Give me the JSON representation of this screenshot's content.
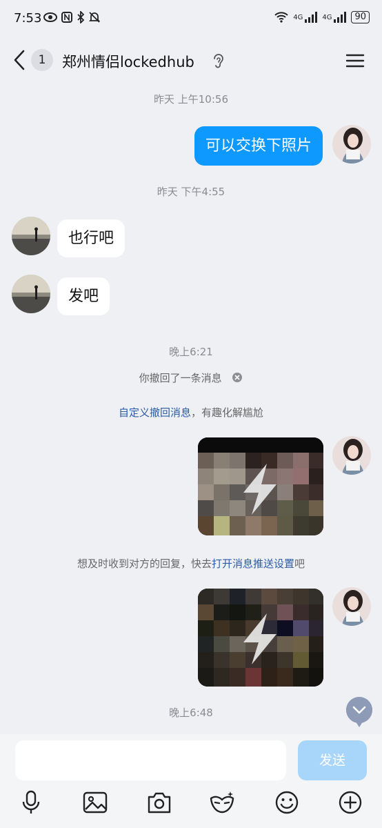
{
  "status_bar": {
    "time": "7:53",
    "signal1": "4G",
    "signal2": "4G",
    "battery": "90"
  },
  "header": {
    "unread_count": "1",
    "title": "郑州情侣lockedhub"
  },
  "messages": {
    "ts1": "昨天 上午10:56",
    "msg1": "可以交换下照片",
    "ts2": "昨天 下午4:55",
    "msg2": "也行吧",
    "msg3": "发吧",
    "ts3": "晚上6:21",
    "recall_notice": "你撤回了一条消息",
    "custom_recall_link": "自定义撤回消息",
    "custom_recall_rest": "，有趣化解尴尬",
    "push_prefix": "想及时收到对方的回复，快去",
    "push_link": "打开消息推送设置",
    "push_suffix": "吧",
    "ts4": "晚上6:48"
  },
  "input": {
    "placeholder": "",
    "send_label": "发送"
  },
  "toolbar": [
    "microphone-icon",
    "image-icon",
    "camera-icon",
    "mask-icon",
    "emoji-icon",
    "plus-icon"
  ],
  "colors": {
    "self_bubble": "#0d99ff",
    "background": "#eff0f4",
    "link": "#2a5ba8",
    "send_disabled": "#a8d6fb"
  }
}
